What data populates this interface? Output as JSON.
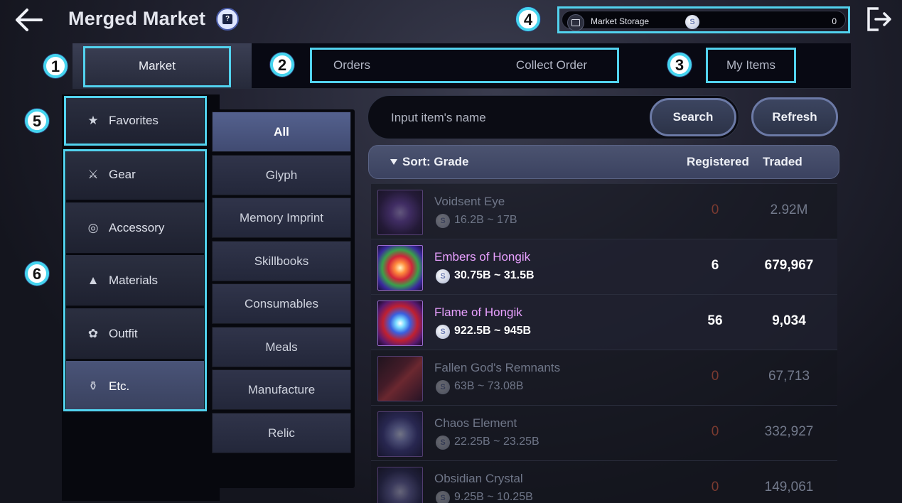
{
  "header": {
    "title": "Merged Market",
    "help_icon": "guide-book-icon",
    "back_icon": "arrow-left-icon",
    "exit_icon": "exit-door-icon"
  },
  "storage": {
    "label": "Market Storage",
    "coin_symbol": "S",
    "value": "0",
    "icon": "chest-icon"
  },
  "badges": [
    "1",
    "2",
    "3",
    "4",
    "5",
    "6"
  ],
  "tabs": {
    "market": "Market",
    "orders": "Orders",
    "collect_order": "Collect Order",
    "my_items": "My Items"
  },
  "categories": [
    {
      "label": "Favorites",
      "icon": "star-icon",
      "active": false
    },
    {
      "label": "Gear",
      "icon": "crossed-swords-icon",
      "active": false
    },
    {
      "label": "Accessory",
      "icon": "ring-icon",
      "active": false
    },
    {
      "label": "Materials",
      "icon": "flask-icon",
      "active": false
    },
    {
      "label": "Outfit",
      "icon": "outfit-icon",
      "active": false
    },
    {
      "label": "Etc.",
      "icon": "potion-icon",
      "active": true
    }
  ],
  "subcategories": [
    {
      "label": "All",
      "active": true
    },
    {
      "label": "Glyph",
      "active": false
    },
    {
      "label": "Memory Imprint",
      "active": false
    },
    {
      "label": "Skillbooks",
      "active": false
    },
    {
      "label": "Consumables",
      "active": false
    },
    {
      "label": "Meals",
      "active": false
    },
    {
      "label": "Manufacture",
      "active": false
    },
    {
      "label": "Relic",
      "active": false
    }
  ],
  "search": {
    "placeholder": "Input item's name",
    "button": "Search",
    "refresh": "Refresh"
  },
  "list_header": {
    "sort": "Sort: Grade",
    "registered": "Registered",
    "traded": "Traded"
  },
  "items": [
    {
      "name": "Voidsent Eye",
      "price": "16.2B ~ 17B",
      "registered": "0",
      "traded": "2.92M",
      "available": false
    },
    {
      "name": "Embers of Hongik",
      "price": "30.75B ~ 31.5B",
      "registered": "6",
      "traded": "679,967",
      "available": true
    },
    {
      "name": "Flame of Hongik",
      "price": "922.5B ~ 945B",
      "registered": "56",
      "traded": "9,034",
      "available": true
    },
    {
      "name": "Fallen God's Remnants",
      "price": "63B ~ 73.08B",
      "registered": "0",
      "traded": "67,713",
      "available": false
    },
    {
      "name": "Chaos Element",
      "price": "22.25B ~ 23.25B",
      "registered": "0",
      "traded": "332,927",
      "available": false
    },
    {
      "name": "Obsidian Crystal",
      "price": "9.25B ~ 10.25B",
      "registered": "0",
      "traded": "149,061",
      "available": false
    }
  ],
  "colors": {
    "highlight": "#52d2ee",
    "item_name_available": "#e8a0ff",
    "registered_zero": "#7a3a30"
  }
}
